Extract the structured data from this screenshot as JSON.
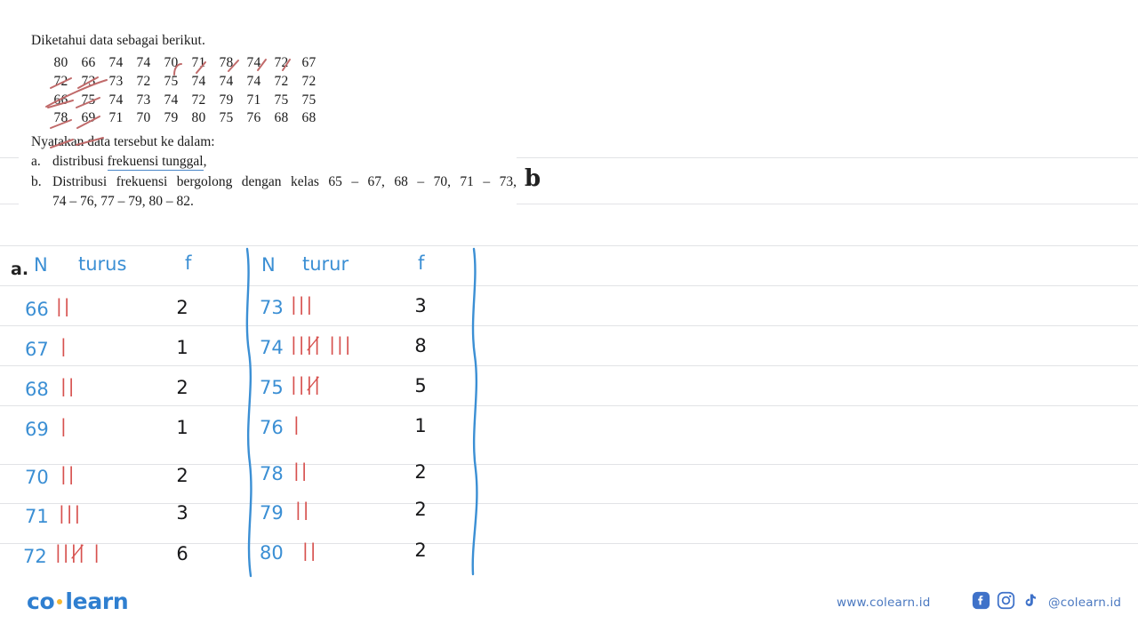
{
  "question": {
    "intro": "Diketahui data sebagai berikut.",
    "data_rows": [
      [
        "80",
        "66",
        "74",
        "74",
        "70",
        "71",
        "78",
        "74",
        "72",
        "67"
      ],
      [
        "72",
        "73",
        "73",
        "72",
        "75",
        "74",
        "74",
        "74",
        "72",
        "72"
      ],
      [
        "66",
        "75",
        "74",
        "73",
        "74",
        "72",
        "79",
        "71",
        "75",
        "75"
      ],
      [
        "78",
        "69",
        "71",
        "70",
        "79",
        "80",
        "75",
        "76",
        "68",
        "68"
      ]
    ],
    "statement": "Nyatakan data tersebut ke dalam:",
    "items": [
      {
        "marker": "a.",
        "text_before": "distribusi ",
        "text_underlined": "frekuensi tunggal",
        "text_after": ","
      },
      {
        "marker": "b.",
        "line1": "Distribusi frekuensi bergolong dengan kelas 65 – 67, 68 – 70, 71 – 73,",
        "line2": "74 – 76, 77 – 79, 80 – 82."
      }
    ]
  },
  "answer": {
    "part_marker": "a.",
    "part_b_mark": "b",
    "headers": {
      "n": "N",
      "turus": "turus",
      "f": "f"
    },
    "headers_right": {
      "n": "N",
      "turus": "turur",
      "f": "f"
    },
    "left_column": [
      {
        "n": "66",
        "tally": "||",
        "f": "2"
      },
      {
        "n": "67",
        "tally": "|",
        "f": "1"
      },
      {
        "n": "68",
        "tally": "||",
        "f": "2"
      },
      {
        "n": "69",
        "tally": "|",
        "f": "1"
      },
      {
        "n": "70",
        "tally": "||",
        "f": "2"
      },
      {
        "n": "71",
        "tally": "|||",
        "f": "3"
      },
      {
        "n": "72",
        "tally": "||||̸ |",
        "f": "6"
      }
    ],
    "right_column": [
      {
        "n": "73",
        "tally": "|||",
        "f": "3"
      },
      {
        "n": "74",
        "tally": "||||̸ |||",
        "f": "8"
      },
      {
        "n": "75",
        "tally": "||||̸",
        "f": "5"
      },
      {
        "n": "76",
        "tally": "|",
        "f": "1"
      },
      {
        "n": "78",
        "tally": "||",
        "f": "2"
      },
      {
        "n": "79",
        "tally": "||",
        "f": "2"
      },
      {
        "n": "80",
        "tally": "||",
        "f": "2"
      }
    ]
  },
  "footer": {
    "logo_left": "co",
    "logo_right": "learn",
    "website": "www.colearn.id",
    "handle": "@colearn.id",
    "icons": [
      "facebook-icon",
      "instagram-icon",
      "tiktok-icon"
    ]
  },
  "colors": {
    "ink_blue": "#3b8fd4",
    "ink_red": "#d7514e",
    "ink_black": "#18181a",
    "rule_line": "#e2e3e6",
    "brand_blue": "#2f7fd0",
    "brand_yellow": "#f5b731"
  }
}
